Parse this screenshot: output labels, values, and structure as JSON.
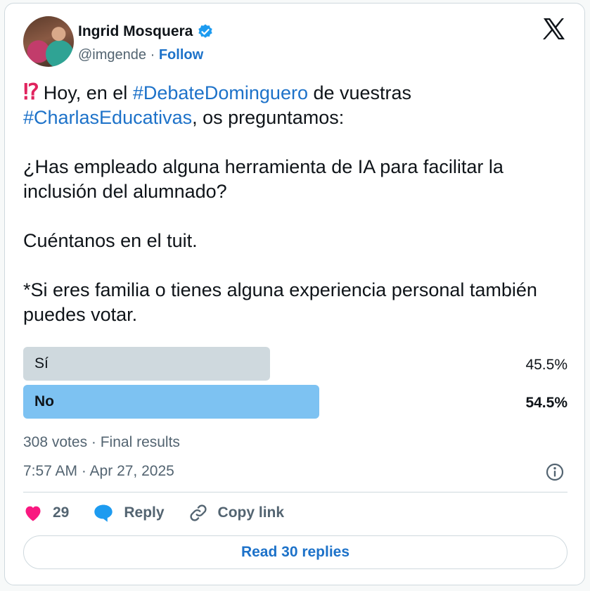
{
  "author": {
    "name": "Ingrid Mosquera",
    "handle": "@imgende",
    "separator": "·",
    "follow_label": "Follow"
  },
  "tweet": {
    "line1_prefix": "Hoy, en el ",
    "hashtag1": "#DebateDominguero",
    "line1_suffix": " de vuestras",
    "hashtag2": "#CharlasEducativas",
    "line2_suffix": ", os preguntamos:",
    "paragraph2": "¿Has empleado alguna herramienta de IA para facilitar la inclusión del alumnado?",
    "paragraph3": "Cuéntanos en el tuit.",
    "paragraph4": "*Si eres familia o tienes alguna experiencia personal también puedes votar.",
    "emoji": "⁉"
  },
  "poll": {
    "options": [
      {
        "label": "Sí",
        "percent_text": "45.5%",
        "value": 45.5
      },
      {
        "label": "No",
        "percent_text": "54.5%",
        "value": 54.5
      }
    ],
    "summary": "308 votes · Final results"
  },
  "timestamp": "7:57 AM · Apr 27, 2025",
  "actions": {
    "likes": "29",
    "reply_label": "Reply",
    "copy_label": "Copy link"
  },
  "read_replies_label": "Read 30 replies",
  "colors": {
    "link": "#1d72c9",
    "like": "#f91880",
    "winner_bar": "#7dc2f2",
    "loser_bar": "#cfd9de"
  }
}
